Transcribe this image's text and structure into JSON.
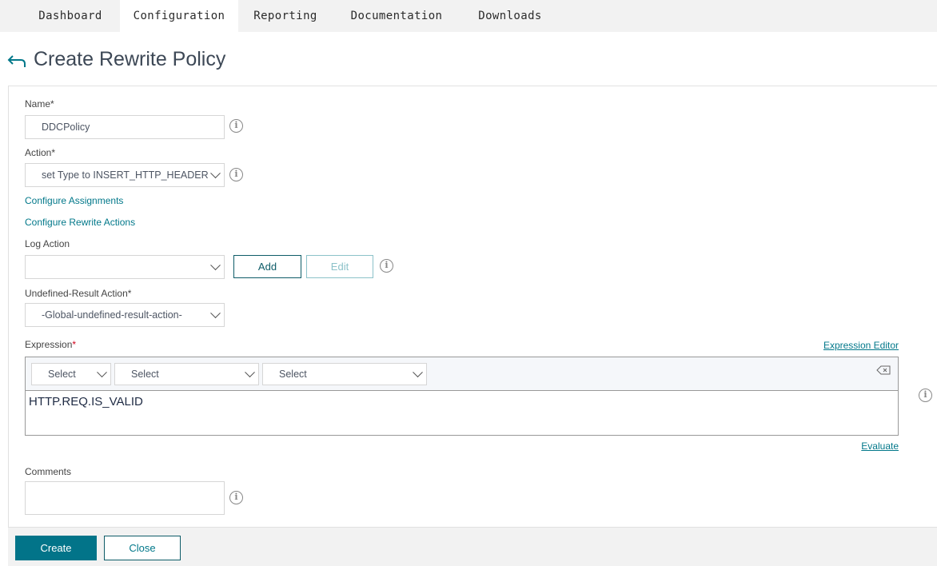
{
  "tabs": [
    {
      "label": "Dashboard"
    },
    {
      "label": "Configuration",
      "active": true
    },
    {
      "label": "Reporting"
    },
    {
      "label": "Documentation"
    },
    {
      "label": "Downloads"
    }
  ],
  "page": {
    "title": "Create Rewrite Policy",
    "back_icon": "back-arrow-icon"
  },
  "form": {
    "name_label": "Name*",
    "name_value": "DDCPolicy",
    "action_label": "Action*",
    "action_value": "set Type to INSERT_HTTP_HEADER",
    "configure_assignments": "Configure Assignments",
    "configure_rewrite_actions": "Configure Rewrite Actions",
    "log_action_label": "Log Action",
    "log_action_value": "",
    "add_label": "Add",
    "edit_label": "Edit",
    "undefined_label": "Undefined-Result Action*",
    "undefined_value": "-Global-undefined-result-action-",
    "expression_label": "Expression",
    "required_mark": "*",
    "expression_editor": "Expression Editor",
    "selects": [
      "Select",
      "Select",
      "Select"
    ],
    "expression_value": "HTTP.REQ.IS_VALID",
    "evaluate": "Evaluate",
    "comments_label": "Comments",
    "comments_value": ""
  },
  "footer": {
    "create_label": "Create",
    "close_label": "Close"
  },
  "colors": {
    "accent": "#02788a",
    "button_primary": "#027489",
    "text_dark": "#3d4856"
  }
}
